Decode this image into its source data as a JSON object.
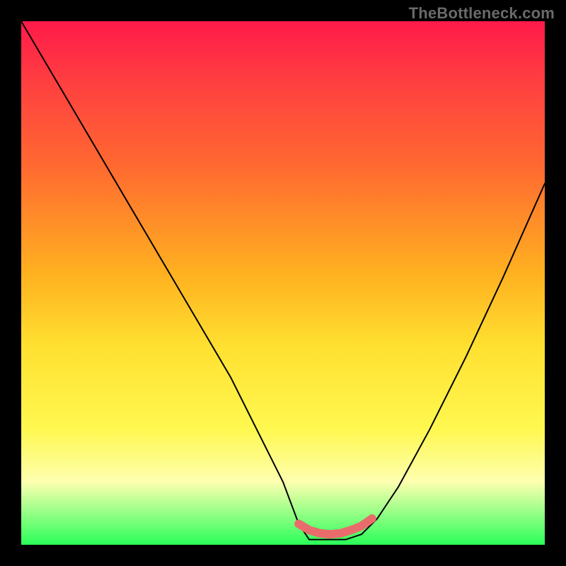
{
  "watermark": "TheBottleneck.com",
  "chart_data": {
    "type": "line",
    "title": "",
    "xlabel": "",
    "ylabel": "",
    "xlim": [
      0,
      100
    ],
    "ylim": [
      0,
      100
    ],
    "grid": false,
    "series": [
      {
        "name": "bottleneck-curve",
        "x": [
          0,
          10,
          20,
          30,
          40,
          45,
          50,
          53,
          55,
          58,
          62,
          65,
          68,
          72,
          78,
          85,
          92,
          100
        ],
        "values": [
          100,
          83,
          66,
          49,
          32,
          22,
          12,
          4,
          1,
          1,
          1,
          2,
          5,
          11,
          22,
          36,
          51,
          69
        ],
        "color": "#000000",
        "stroke_width": 2
      },
      {
        "name": "marker-band",
        "x": [
          53,
          55,
          57,
          59,
          61,
          63,
          65,
          67
        ],
        "values": [
          4.0,
          2.8,
          2.2,
          2.0,
          2.2,
          2.8,
          3.6,
          5.0
        ],
        "color": "#ea6b6b",
        "stroke_width": 12
      }
    ],
    "legend": null
  }
}
